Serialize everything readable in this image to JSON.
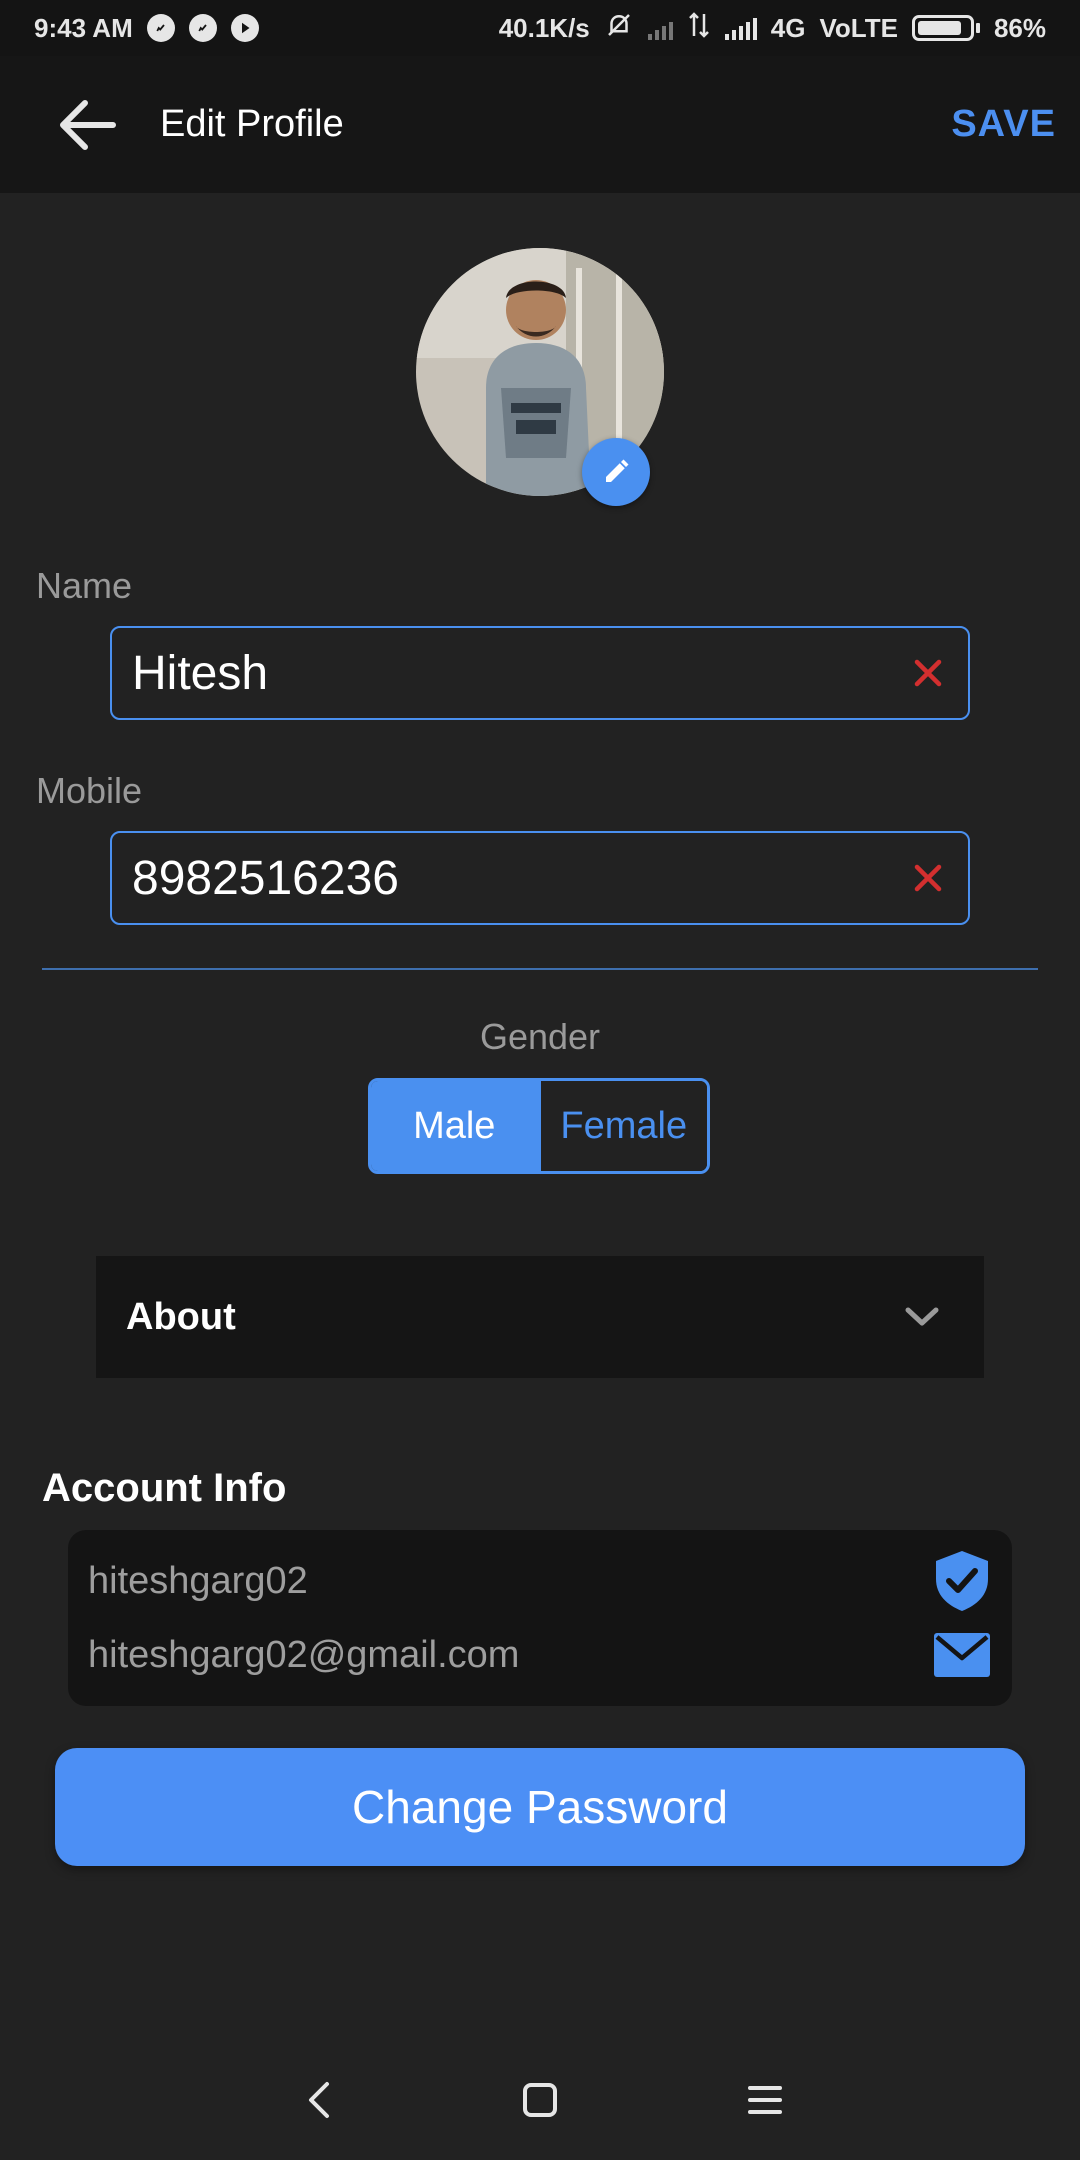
{
  "status_bar": {
    "time": "9:43 AM",
    "net_speed": "40.1K/s",
    "network_type": "4G",
    "volte": "VoLTE",
    "battery": "86%",
    "battery_level": 0.86,
    "notification_icons": [
      "whatsapp-icon",
      "whatsapp-icon",
      "play-store-icon"
    ]
  },
  "app_bar": {
    "title": "Edit Profile",
    "save_label": "SAVE",
    "back_icon": "arrow-left-icon"
  },
  "profile": {
    "avatar_edit_icon": "pencil-icon"
  },
  "form": {
    "name": {
      "label": "Name",
      "value": "Hitesh",
      "clear_icon": "close-icon"
    },
    "mobile": {
      "label": "Mobile",
      "value": "8982516236",
      "clear_icon": "close-icon"
    }
  },
  "gender": {
    "label": "Gender",
    "options": [
      "Male",
      "Female"
    ],
    "selected": "Male"
  },
  "about": {
    "title": "About",
    "icon": "chevron-down-icon"
  },
  "account_info": {
    "heading": "Account Info",
    "username": "hiteshgarg02",
    "email": "hiteshgarg02@gmail.com",
    "username_icon": "verified-shield-icon",
    "email_icon": "mail-icon"
  },
  "change_password": {
    "label": "Change Password"
  },
  "nav_bar": {
    "icons": [
      "back-nav-icon",
      "home-nav-icon",
      "menu-nav-icon"
    ]
  },
  "colors": {
    "accent": "#4A90F0",
    "background": "#222222",
    "app_bar": "#161616",
    "clear_icon": "#D32F2F",
    "muted_text": "#9A9A9A"
  }
}
